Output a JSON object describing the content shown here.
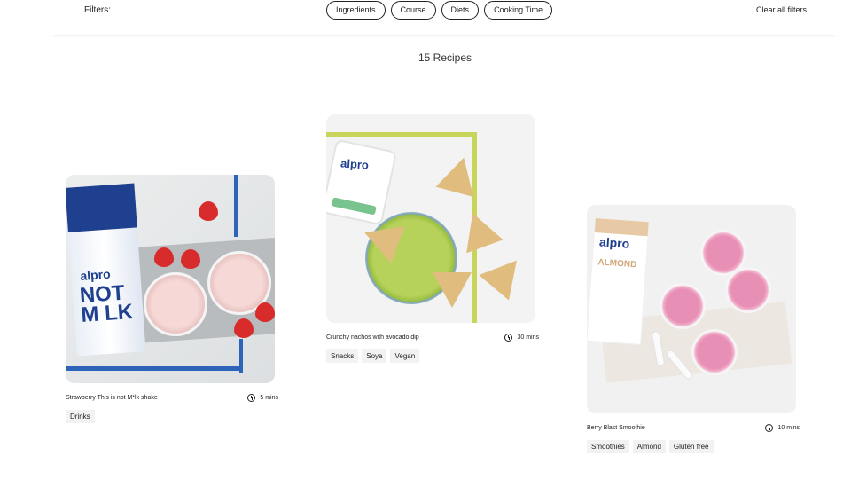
{
  "filters": {
    "label": "Filters:",
    "pills": [
      "Ingredients",
      "Course",
      "Diets",
      "Cooking Time"
    ],
    "clear_all": "Clear all filters"
  },
  "results": {
    "count_text": "15 Recipes"
  },
  "recipes": [
    {
      "title": "Strawberry This is not M*lk shake",
      "time": "5 mins",
      "tags": [
        "Drinks"
      ],
      "image_text": {
        "brand": "alpro",
        "product": "NOT M LK"
      }
    },
    {
      "title": "Crunchy nachos with avocado dip",
      "time": "30 mins",
      "tags": [
        "Snacks",
        "Soya",
        "Vegan"
      ],
      "image_text": {
        "brand": "alpro"
      }
    },
    {
      "title": "Berry Blast Smoothie",
      "time": "10 mins",
      "tags": [
        "Smoothies",
        "Almond",
        "Gluten free"
      ],
      "image_text": {
        "brand": "alpro",
        "product": "ALMOND"
      }
    }
  ]
}
